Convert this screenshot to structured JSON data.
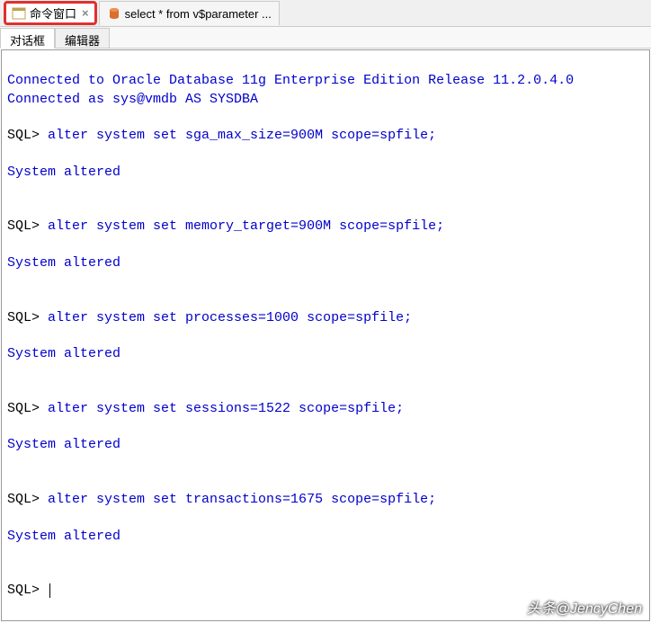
{
  "tabs": {
    "tab1": {
      "label": "命令窗口"
    },
    "tab2": {
      "label": "select * from v$parameter  ..."
    }
  },
  "sub_tabs": {
    "dialog": "对话框",
    "editor": "编辑器"
  },
  "terminal": {
    "line1": "Connected to Oracle Database 11g Enterprise Edition Release 11.2.0.4.0",
    "line2": "Connected as sys@vmdb AS SYSDBA",
    "prompt": "SQL> ",
    "cmd1": "alter system set sga_max_size=900M scope=spfile;",
    "result": "System altered",
    "cmd2": "alter system set memory_target=900M scope=spfile;",
    "cmd3": "alter system set processes=1000 scope=spfile;",
    "cmd4": "alter system set sessions=1522 scope=spfile;",
    "cmd5": "alter system set transactions=1675 scope=spfile;"
  },
  "watermark": "头条@JencyChen"
}
